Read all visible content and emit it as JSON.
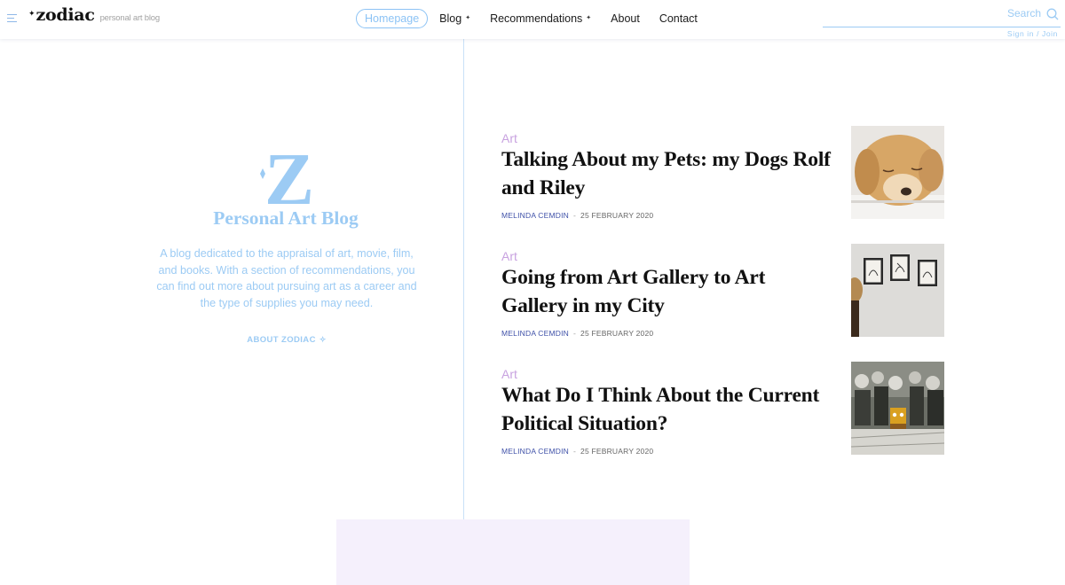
{
  "header": {
    "logo": {
      "text": "zodiac",
      "star": "✦",
      "tagline": "personal art blog"
    },
    "nav": [
      {
        "label": "Homepage",
        "active": true,
        "has_dropdown": false
      },
      {
        "label": "Blog",
        "active": false,
        "has_dropdown": true
      },
      {
        "label": "Recommendations",
        "active": false,
        "has_dropdown": true
      },
      {
        "label": "About",
        "active": false,
        "has_dropdown": false
      },
      {
        "label": "Contact",
        "active": false,
        "has_dropdown": false
      }
    ],
    "caret": "✦",
    "search": {
      "label": "Search",
      "value": ""
    },
    "signin": "Sign in / Join"
  },
  "hero": {
    "logo_letter": "Z",
    "title": "Personal Art Blog",
    "description": "A blog dedicated to the appraisal of art, movie, film, and books. With a section of recommendations, you can find out more about pursuing art as a career and the type of supplies you may need.",
    "link": "ABOUT ZODIAC",
    "link_icon": "✧"
  },
  "posts": [
    {
      "category": "Art",
      "title": "Talking About my Pets: my Dogs Rolf and Riley",
      "author": "MELINDA CEMDIN",
      "separator": "-",
      "date": "25 FEBRUARY 2020",
      "thumbnail": "sleeping-dog-photo"
    },
    {
      "category": "Art",
      "title": "Going from Art Gallery to Art Gallery in my City",
      "author": "MELINDA CEMDIN",
      "separator": "-",
      "date": "25 FEBRUARY 2020",
      "thumbnail": "gallery-frames-photo"
    },
    {
      "category": "Art",
      "title": "What Do I Think About the Current Political Situation?",
      "author": "MELINDA CEMDIN",
      "separator": "-",
      "date": "25 FEBRUARY 2020",
      "thumbnail": "crowd-collage-photo"
    }
  ],
  "colors": {
    "accent_blue": "#9ccbf4",
    "category_purple": "#c8a2e0",
    "author_blue": "#3f51a8",
    "bottom_block": "#f5f0fc"
  }
}
